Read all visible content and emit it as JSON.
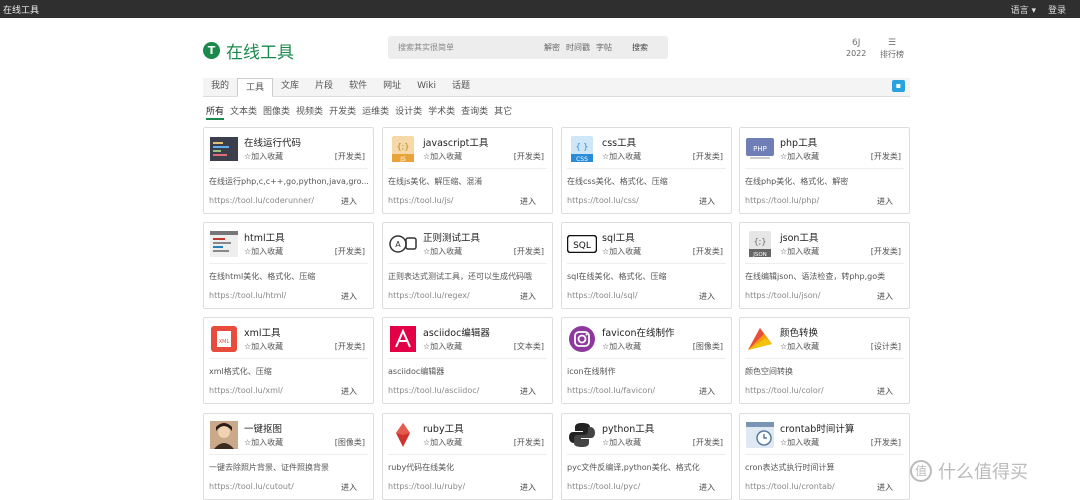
{
  "topbar": {
    "brand": "在线工具",
    "language": "语言 ▾",
    "login": "登录"
  },
  "logo": {
    "glyph": "T",
    "name": "在线工具"
  },
  "search": {
    "placeholder": "搜索其实很简单",
    "tags": [
      "解密",
      "时间戳",
      "字帖"
    ],
    "button": "搜索"
  },
  "stats": [
    {
      "top": "6J",
      "bottom": "2022"
    },
    {
      "top": "☰",
      "bottom": "排行榜"
    }
  ],
  "tabs": [
    "我的",
    "工具",
    "文库",
    "片段",
    "软件",
    "网址",
    "Wiki",
    "话题"
  ],
  "active_tab": 1,
  "categories": [
    "所有",
    "文本类",
    "图像类",
    "视频类",
    "开发类",
    "运维类",
    "设计类",
    "学术类",
    "查询类",
    "其它"
  ],
  "fav_label": "☆加入收藏",
  "enter_label": "进入",
  "cards": [
    {
      "title": "在线运行代码",
      "cat": "[开发类]",
      "desc": "在线运行php,c,c++,go,python,java,gro...",
      "url": "https://tool.lu/coderunner/",
      "icon": "code-editor-icon"
    },
    {
      "title": "javascript工具",
      "cat": "[开发类]",
      "desc": "在线js美化、解压缩、混淆",
      "url": "https://tool.lu/js/",
      "icon": "js-file-icon"
    },
    {
      "title": "css工具",
      "cat": "[开发类]",
      "desc": "在线css美化、格式化、压缩",
      "url": "https://tool.lu/css/",
      "icon": "css-file-icon"
    },
    {
      "title": "php工具",
      "cat": "[开发类]",
      "desc": "在线php美化、格式化、解密",
      "url": "https://tool.lu/php/",
      "icon": "php-icon"
    },
    {
      "title": "html工具",
      "cat": "[开发类]",
      "desc": "在线html美化、格式化、压缩",
      "url": "https://tool.lu/html/",
      "icon": "html-editor-icon"
    },
    {
      "title": "正则测试工具",
      "cat": "[开发类]",
      "desc": "正则表达式测试工具，还可以生成代码哦",
      "url": "https://tool.lu/regex/",
      "icon": "regex-icon"
    },
    {
      "title": "sql工具",
      "cat": "[开发类]",
      "desc": "sql在线美化、格式化、压缩",
      "url": "https://tool.lu/sql/",
      "icon": "sql-icon"
    },
    {
      "title": "json工具",
      "cat": "[开发类]",
      "desc": "在线编辑json、语法检查，转php,go类",
      "url": "https://tool.lu/json/",
      "icon": "json-file-icon"
    },
    {
      "title": "xml工具",
      "cat": "[开发类]",
      "desc": "xml格式化、压缩",
      "url": "https://tool.lu/xml/",
      "icon": "xml-file-icon"
    },
    {
      "title": "asciidoc编辑器",
      "cat": "[文本类]",
      "desc": "asciidoc编辑器",
      "url": "https://tool.lu/asciidoc/",
      "icon": "asciidoc-icon"
    },
    {
      "title": "favicon在线制作",
      "cat": "[图像类]",
      "desc": "icon在线制作",
      "url": "https://tool.lu/favicon/",
      "icon": "instagram-icon"
    },
    {
      "title": "颜色转换",
      "cat": "[设计类]",
      "desc": "颜色空间转换",
      "url": "https://tool.lu/color/",
      "icon": "color-palette-icon"
    },
    {
      "title": "一键抠图",
      "cat": "[图像类]",
      "desc": "一键去除照片背景、证件照换背景",
      "url": "https://tool.lu/cutout/",
      "icon": "portrait-icon"
    },
    {
      "title": "ruby工具",
      "cat": "[开发类]",
      "desc": "ruby代码在线美化",
      "url": "https://tool.lu/ruby/",
      "icon": "ruby-icon"
    },
    {
      "title": "python工具",
      "cat": "[开发类]",
      "desc": "pyc文件反编译,python美化、格式化",
      "url": "https://tool.lu/pyc/",
      "icon": "python-icon"
    },
    {
      "title": "crontab时间计算",
      "cat": "[开发类]",
      "desc": "cron表达式执行时间计算",
      "url": "https://tool.lu/crontab/",
      "icon": "crontab-icon"
    }
  ],
  "watermark": {
    "glyph": "值",
    "text": "什么值得买"
  }
}
